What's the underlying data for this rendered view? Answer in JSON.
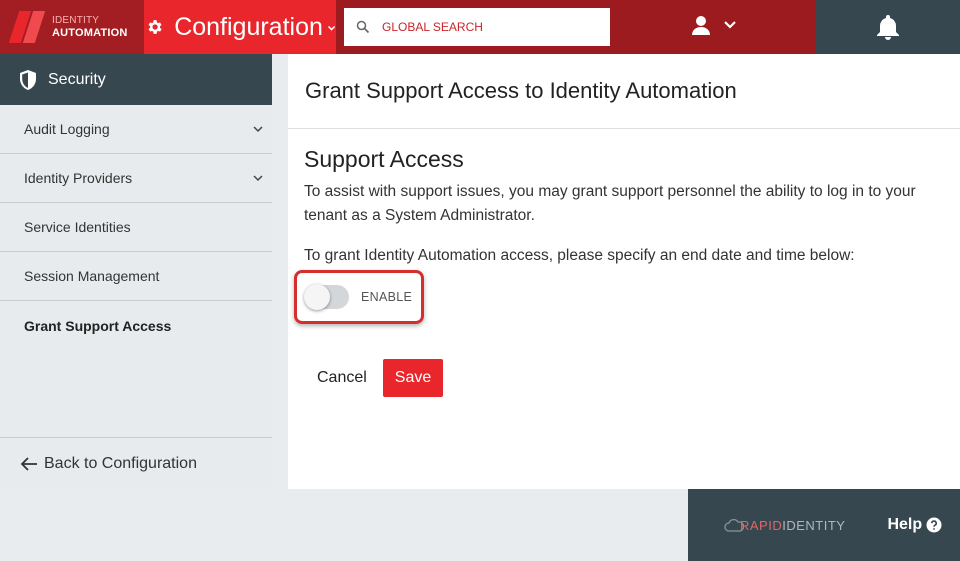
{
  "header": {
    "logo_line1": "IDENTITY",
    "logo_line2": "AUTOMATION",
    "app_title": "Configuration",
    "search_placeholder": "GLOBAL SEARCH"
  },
  "sidebar": {
    "section_title": "Security",
    "items": [
      {
        "label": "Audit Logging",
        "expandable": true
      },
      {
        "label": "Identity Providers",
        "expandable": true
      },
      {
        "label": "Service Identities",
        "expandable": false
      },
      {
        "label": "Session Management",
        "expandable": false
      },
      {
        "label": "Grant Support Access",
        "expandable": false,
        "active": true
      }
    ],
    "back_label": "Back to Configuration"
  },
  "main": {
    "page_title": "Grant Support Access to Identity Automation",
    "section_title": "Support Access",
    "description": "To assist with support issues, you may grant support personnel the ability to log in to your tenant as a System Administrator.",
    "instruction": "To grant Identity Automation access, please specify an end date and time below:",
    "toggle_label": "ENABLE",
    "toggle_enabled": false,
    "cancel_label": "Cancel",
    "save_label": "Save"
  },
  "footer": {
    "brand_part1": "RAPID",
    "brand_part2": "IDENTITY",
    "help_label": "Help"
  },
  "colors": {
    "accent_red": "#e8262b",
    "dark_red": "#9b1b1f",
    "slate": "#37474f"
  }
}
